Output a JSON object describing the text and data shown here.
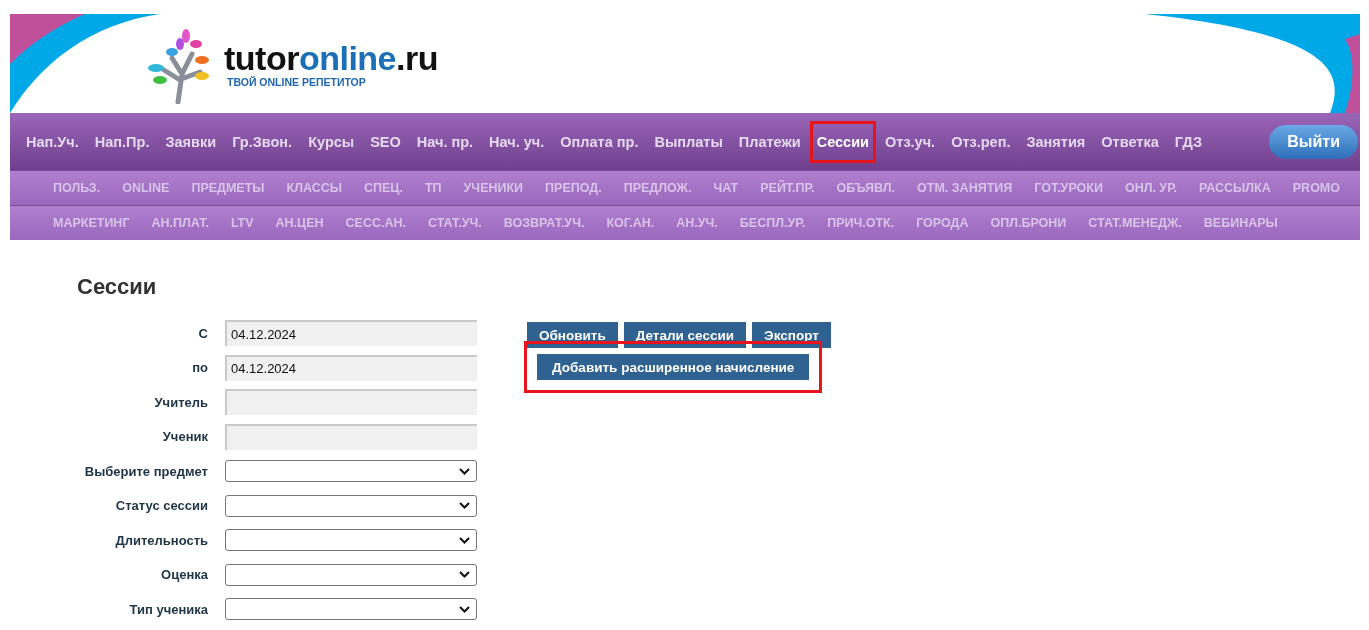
{
  "logo": {
    "text_1": "tutor",
    "text_2": "online",
    "text_3": ".ru",
    "tagline": "ТВОЙ ONLINE РЕПЕТИТОР"
  },
  "main_nav": [
    {
      "label": "Нап.Уч.",
      "selected": false,
      "highlighted": false
    },
    {
      "label": "Нап.Пр.",
      "selected": false,
      "highlighted": false
    },
    {
      "label": "Заявки",
      "selected": false,
      "highlighted": false
    },
    {
      "label": "Гр.Звон.",
      "selected": false,
      "highlighted": false
    },
    {
      "label": "Курсы",
      "selected": false,
      "highlighted": false
    },
    {
      "label": "SEO",
      "selected": false,
      "highlighted": false
    },
    {
      "label": "Нач. пр.",
      "selected": false,
      "highlighted": false
    },
    {
      "label": "Нач. уч.",
      "selected": false,
      "highlighted": false
    },
    {
      "label": "Оплата пр.",
      "selected": false,
      "highlighted": false
    },
    {
      "label": "Выплаты",
      "selected": false,
      "highlighted": false
    },
    {
      "label": "Платежи",
      "selected": false,
      "highlighted": false
    },
    {
      "label": "Сессии",
      "selected": true,
      "highlighted": true
    },
    {
      "label": "Отз.уч.",
      "selected": false,
      "highlighted": false
    },
    {
      "label": "Отз.реп.",
      "selected": false,
      "highlighted": false
    },
    {
      "label": "Занятия",
      "selected": false,
      "highlighted": false
    },
    {
      "label": "Ответка",
      "selected": false,
      "highlighted": false
    },
    {
      "label": "ГДЗ",
      "selected": false,
      "highlighted": false
    }
  ],
  "logout_button": "Выйти",
  "sub_nav_rows": [
    [
      "ПОЛЬЗ.",
      "ONLINE",
      "ПРЕДМЕТЫ",
      "КЛАССЫ",
      "СПЕЦ.",
      "ТП",
      "УЧЕНИКИ",
      "ПРЕПОД.",
      "ПРЕДЛОЖ.",
      "ЧАТ",
      "РЕЙТ.ПР.",
      "ОБЪЯВЛ.",
      "ОТМ. ЗАНЯТИЯ",
      "ГОТ.УРОКИ",
      "ОНЛ. УР.",
      "РАССЫЛКА",
      "PROMO"
    ],
    [
      "МАРКЕТИНГ",
      "АН.ПЛАТ.",
      "LTV",
      "АН.ЦЕН",
      "СЕСС.АН.",
      "СТАТ.УЧ.",
      "ВОЗВРАТ.УЧ.",
      "КОГ.АН.",
      "АН.УЧ.",
      "БЕСПЛ.УР.",
      "ПРИЧ.ОТК.",
      "ГОРОДА",
      "ОПЛ.БРОНИ",
      "СТАТ.МЕНЕДЖ.",
      "ВЕБИНАРЫ"
    ]
  ],
  "page_title": "Сессии",
  "filters": [
    {
      "kind": "text",
      "label": "С",
      "value": "04.12.2024"
    },
    {
      "kind": "text",
      "label": "по",
      "value": "04.12.2024"
    },
    {
      "kind": "text",
      "label": "Учитель"
    },
    {
      "kind": "text",
      "label": "Ученик"
    },
    {
      "kind": "select",
      "label": "Выберите предмет"
    },
    {
      "kind": "select",
      "label": "Статус сессии"
    },
    {
      "kind": "select",
      "label": "Длительность"
    },
    {
      "kind": "select",
      "label": "Оценка"
    },
    {
      "kind": "select",
      "label": "Тип ученика"
    }
  ],
  "button_rows": [
    [
      {
        "label": "Обновить",
        "highlighted": false
      },
      {
        "label": "Детали сессии",
        "highlighted": false
      },
      {
        "label": "Экспорт",
        "highlighted": false
      }
    ],
    [
      {
        "label": "Добавить расширенное начисление",
        "highlighted": true
      }
    ]
  ]
}
